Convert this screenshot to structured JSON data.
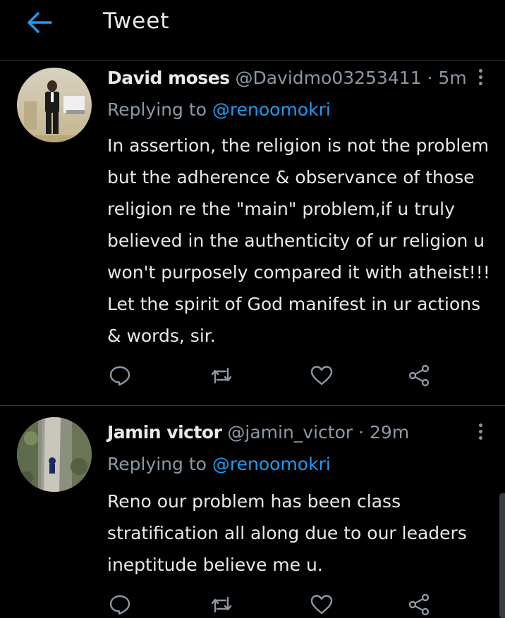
{
  "header": {
    "title": "Tweet"
  },
  "tweets": [
    {
      "name": "David moses",
      "handle": "@Davidmo03253411",
      "separator": "·",
      "time": "5m",
      "replying_prefix": "Replying to",
      "replying_to": "@renoomokri",
      "body": "In assertion, the religion is not the problem but the adherence & observance of those religion re the \"main\" problem,if u truly believed in the authenticity of ur religion u won't purposely compared it with atheist!!! Let the spirit of God manifest in ur actions & words, sir."
    },
    {
      "name": "Jamin victor",
      "handle": "@jamin_victor",
      "separator": "·",
      "time": "29m",
      "replying_prefix": "Replying to",
      "replying_to": "@renoomokri",
      "body": "Reno our problem has been class stratification all along due to our leaders ineptitude believe me u."
    }
  ],
  "icons": {
    "back": "arrow-left-icon",
    "more": "more-vertical-icon",
    "reply": "reply-bubble-icon",
    "retweet": "retweet-icon",
    "like": "heart-icon",
    "share": "share-icon"
  },
  "colors": {
    "background": "#000000",
    "accent": "#1d9bf0",
    "text": "#e7e9ea",
    "muted": "#8b98a5",
    "divider": "#2f3336"
  }
}
